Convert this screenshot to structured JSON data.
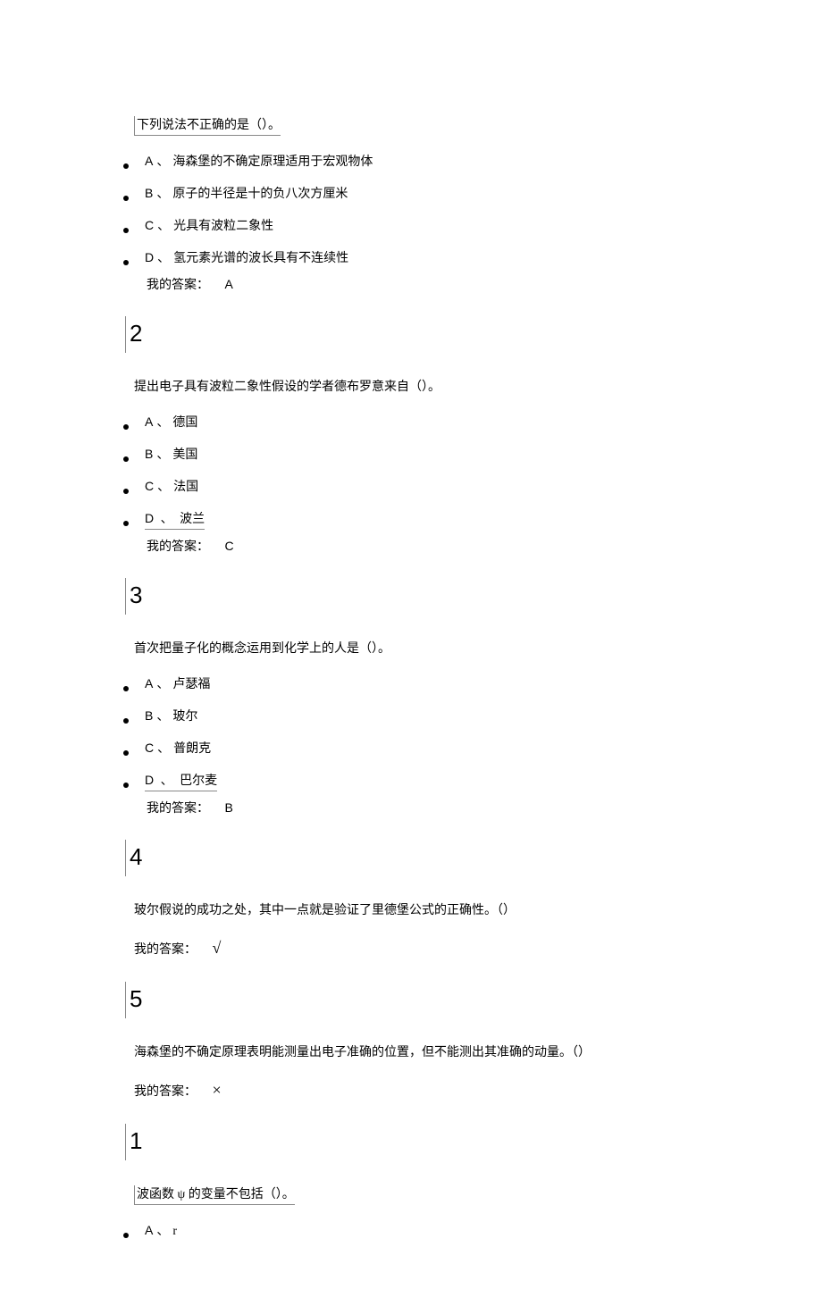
{
  "q1": {
    "text": "下列说法不正确的是（）。",
    "options": {
      "A": "海森堡的不确定原理适用于宏观物体",
      "B": "原子的半径是十的负八次方厘米",
      "C": "光具有波粒二象性",
      "D": "氢元素光谱的波长具有不连续性"
    },
    "answer_prefix": "我的答案：",
    "answer": "A"
  },
  "q2": {
    "number": "2",
    "text": "提出电子具有波粒二象性假设的学者德布罗意来自（）。",
    "options": {
      "A": "德国",
      "B": "美国",
      "C": "法国",
      "D": "波兰"
    },
    "answer_prefix": "我的答案：",
    "answer": "C"
  },
  "q3": {
    "number": "3",
    "text": "首次把量子化的概念运用到化学上的人是（）。",
    "options": {
      "A": "卢瑟福",
      "B": "玻尔",
      "C": "普朗克",
      "D": "巴尔麦"
    },
    "answer_prefix": "我的答案：",
    "answer": "B"
  },
  "q4": {
    "number": "4",
    "text": "玻尔假说的成功之处，其中一点就是验证了里德堡公式的正确性。（）",
    "answer_prefix": "我的答案：",
    "answer": "√"
  },
  "q5": {
    "number": "5",
    "text": "海森堡的不确定原理表明能测量出电子准确的位置，但不能测出其准确的动量。（）",
    "answer_prefix": "我的答案：",
    "answer": "×"
  },
  "q6": {
    "number": "1",
    "text": "波函数 ψ 的变量不包括（）。",
    "options": {
      "A": "r"
    }
  },
  "labels": {
    "A": "A",
    "B": "B",
    "C": "C",
    "D": "D",
    "sep": "、"
  }
}
